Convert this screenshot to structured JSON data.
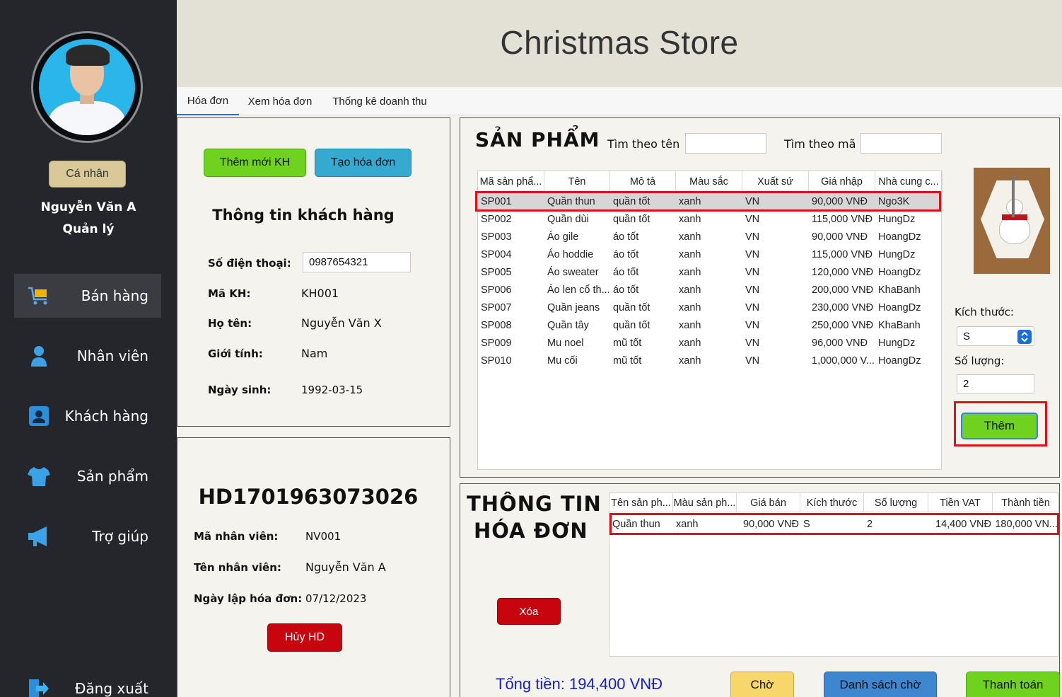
{
  "sidebar": {
    "profile_button": "Cá nhân",
    "user_name": "Nguyễn Văn A",
    "user_role": "Quản lý",
    "items": [
      {
        "label": "Bán hàng",
        "icon": "cart-icon",
        "active": true
      },
      {
        "label": "Nhân viên",
        "icon": "person-icon",
        "active": false
      },
      {
        "label": "Khách hàng",
        "icon": "contact-card-icon",
        "active": false
      },
      {
        "label": "Sản phẩm",
        "icon": "tshirt-icon",
        "active": false
      },
      {
        "label": "Trợ giúp",
        "icon": "megaphone-icon",
        "active": false
      }
    ],
    "logout": {
      "label": "Đăng xuất",
      "icon": "logout-icon"
    }
  },
  "header": {
    "title": "Christmas Store"
  },
  "tabs": [
    {
      "label": "Hóa đơn",
      "active": true
    },
    {
      "label": "Xem hóa đơn",
      "active": false
    },
    {
      "label": "Thống kê doanh thu",
      "active": false
    }
  ],
  "customer": {
    "add_button": "Thêm mới KH",
    "create_invoice_button": "Tạo hóa đơn",
    "title": "Thông tin khách hàng",
    "phone_label": "Số điện thoại:",
    "phone_value": "0987654321",
    "id_label": "Mã KH:",
    "id_value": "KH001",
    "name_label": "Họ tên:",
    "name_value": "Nguyễn Văn X",
    "gender_label": "Giới tính:",
    "gender_value": "Nam",
    "dob_label": "Ngày sinh:",
    "dob_value": "1992-03-15"
  },
  "invoice_info": {
    "code": "HD1701963073026",
    "staff_id_label": "Mã nhân viên:",
    "staff_id_value": "NV001",
    "staff_name_label": "Tên nhân viên:",
    "staff_name_value": "Nguyễn Văn A",
    "date_label": "Ngày lập hóa đơn:",
    "date_value": "07/12/2023",
    "cancel_button": "Hủy HD"
  },
  "products": {
    "title": "SẢN PHẨM",
    "search_name_label": "Tìm theo tên",
    "search_name_value": "",
    "search_code_label": "Tìm theo mã",
    "search_code_value": "",
    "columns": [
      "Mã sản phẩ...",
      "Tên",
      "Mô tả",
      "Màu sắc",
      "Xuất sứ",
      "Giá nhập",
      "Nhà cung c..."
    ],
    "rows": [
      [
        "SP001",
        "Quần thun",
        "quần tốt",
        "xanh",
        "VN",
        "90,000 VNĐ",
        "Ngo3K"
      ],
      [
        "SP002",
        "Quần dùi",
        "quần tốt",
        "xanh",
        "VN",
        "115,000 VNĐ",
        "HungDz"
      ],
      [
        "SP003",
        "Áo gile",
        "áo tốt",
        "xanh",
        "VN",
        "90,000 VNĐ",
        "HoangDz"
      ],
      [
        "SP004",
        "Áo hoddie",
        "áo tốt",
        "xanh",
        "VN",
        "115,000 VNĐ",
        "HungDz"
      ],
      [
        "SP005",
        "Áo sweater",
        "áo tốt",
        "xanh",
        "VN",
        "120,000 VNĐ",
        "HoangDz"
      ],
      [
        "SP006",
        "Áo len cổ th...",
        "áo tốt",
        "xanh",
        "VN",
        "200,000 VNĐ",
        "KhaBanh"
      ],
      [
        "SP007",
        "Quần jeans",
        "quần tốt",
        "xanh",
        "VN",
        "230,000 VNĐ",
        "HoangDz"
      ],
      [
        "SP008",
        "Quần tây",
        "quần tốt",
        "xanh",
        "VN",
        "250,000 VNĐ",
        "KhaBanh"
      ],
      [
        "SP009",
        "Mu noel",
        "mũ tốt",
        "xanh",
        "VN",
        "96,000 VNĐ",
        "HungDz"
      ],
      [
        "SP010",
        "Mu cối",
        "mũ tốt",
        "xanh",
        "VN",
        "1,000,000 V...",
        "HoangDz"
      ]
    ],
    "size_label": "Kích thước:",
    "size_value": "S",
    "quantity_label": "Số lượng:",
    "quantity_value": "2",
    "add_button": "Thêm"
  },
  "invoice": {
    "title_line1": "THÔNG TIN",
    "title_line2": "HÓA ĐƠN",
    "delete_button": "Xóa",
    "columns": [
      "Tên sản ph...",
      "Màu sản ph...",
      "Giá bán",
      "Kích thước",
      "Số lượng",
      "Tiền VAT",
      "Thành tiền"
    ],
    "rows": [
      [
        "Quần thun",
        "xanh",
        "90,000 VNĐ",
        "S",
        "2",
        "14,400 VNĐ",
        "180,000 VN..."
      ]
    ],
    "total": "Tổng tiền: 194,400 VNĐ",
    "wait_button": "Chờ",
    "wait_list_button": "Danh sách chờ",
    "pay_button": "Thanh toán"
  },
  "colors": {
    "sidebar_bg": "#24262b",
    "header_bg": "#e3e1d6",
    "green": "#6fd21f",
    "teal": "#36a9d0",
    "red": "#c8050f",
    "yellow": "#f7d66a",
    "blue": "#3f86d0",
    "highlight": "#e0101a",
    "total_text": "#1420c8"
  }
}
